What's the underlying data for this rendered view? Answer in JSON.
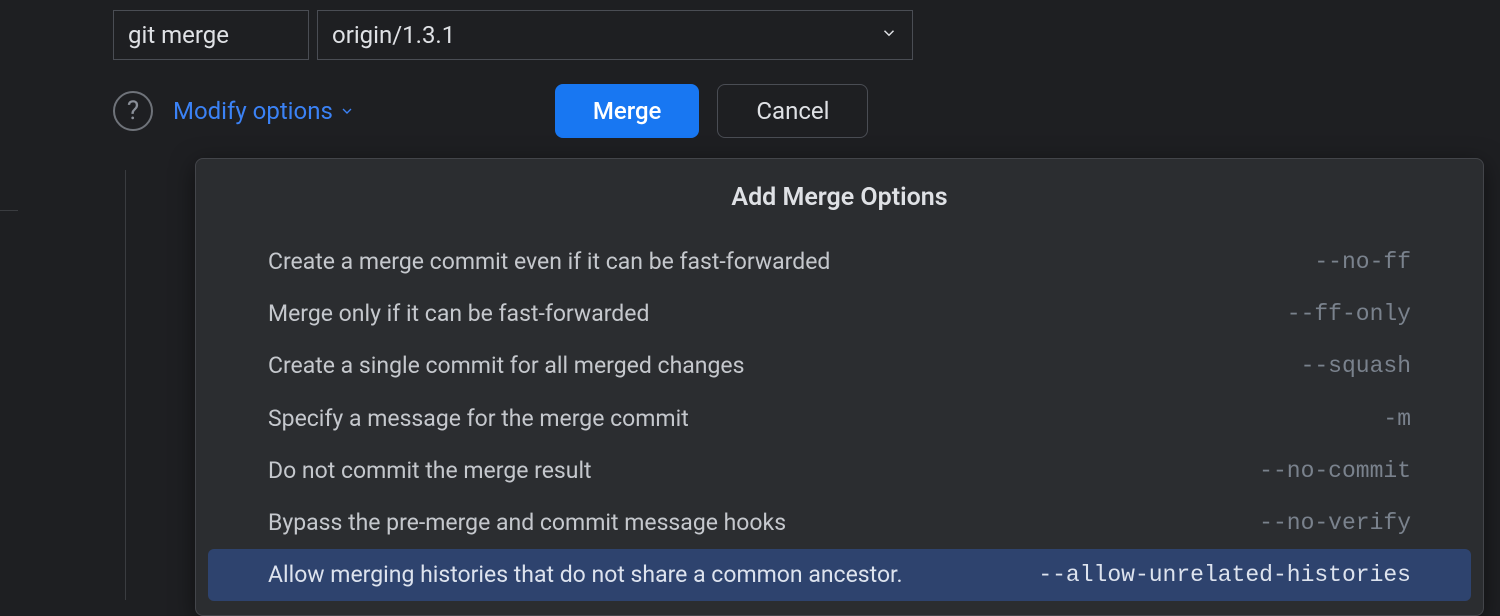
{
  "command": {
    "label": "git merge",
    "branch": "origin/1.3.1"
  },
  "controls": {
    "help_tooltip": "?",
    "modify_label": "Modify options",
    "merge_button": "Merge",
    "cancel_button": "Cancel"
  },
  "panel": {
    "title": "Add Merge Options",
    "options": [
      {
        "desc": "Create a merge commit even if it can be fast-forwarded",
        "flag": "--no-ff",
        "selected": false
      },
      {
        "desc": "Merge only if it can be fast-forwarded",
        "flag": "--ff-only",
        "selected": false
      },
      {
        "desc": "Create a single commit for all merged changes",
        "flag": "--squash",
        "selected": false
      },
      {
        "desc": "Specify a message for the merge commit",
        "flag": "-m",
        "selected": false
      },
      {
        "desc": "Do not commit the merge result",
        "flag": "--no-commit",
        "selected": false
      },
      {
        "desc": "Bypass the pre-merge and commit message hooks",
        "flag": "--no-verify",
        "selected": false
      },
      {
        "desc": "Allow merging histories that do not share a common ancestor.",
        "flag": "--allow-unrelated-histories",
        "selected": true
      }
    ]
  }
}
